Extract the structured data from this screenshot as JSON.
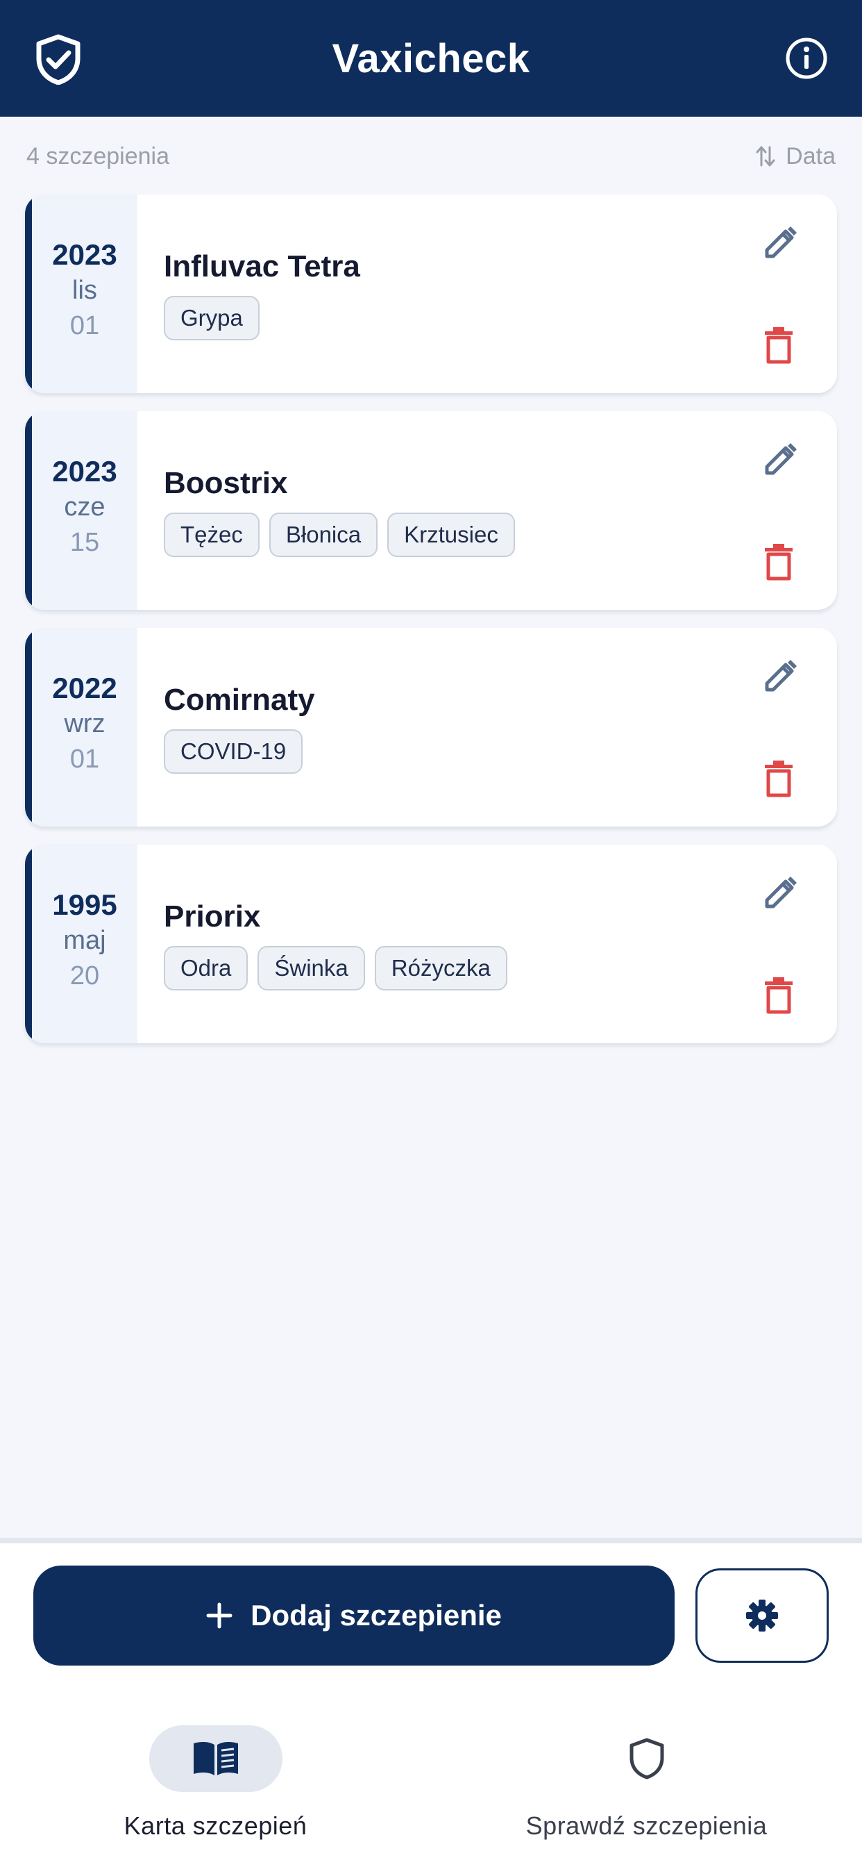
{
  "app": {
    "title": "Vaxicheck"
  },
  "list": {
    "count_label": "4 szczepienia",
    "sort_label": "Data"
  },
  "vaccines": [
    {
      "year": "2023",
      "month": "lis",
      "day": "01",
      "name": "Influvac Tetra",
      "tags": [
        "Grypa"
      ]
    },
    {
      "year": "2023",
      "month": "cze",
      "day": "15",
      "name": "Boostrix",
      "tags": [
        "Tężec",
        "Błonica",
        "Krztusiec"
      ]
    },
    {
      "year": "2022",
      "month": "wrz",
      "day": "01",
      "name": "Comirnaty",
      "tags": [
        "COVID-19"
      ]
    },
    {
      "year": "1995",
      "month": "maj",
      "day": "20",
      "name": "Priorix",
      "tags": [
        "Odra",
        "Świnka",
        "Różyczka"
      ]
    }
  ],
  "actions": {
    "add_label": "Dodaj szczepienie"
  },
  "nav": [
    {
      "label": "Karta szczepień",
      "icon": "book-icon",
      "active": true
    },
    {
      "label": "Sprawdź szczepienia",
      "icon": "shield-icon",
      "active": false
    }
  ],
  "colors": {
    "primary": "#0e2d5c",
    "edit": "#5a6f8e",
    "delete": "#e04848",
    "background": "#f4f6fb"
  }
}
